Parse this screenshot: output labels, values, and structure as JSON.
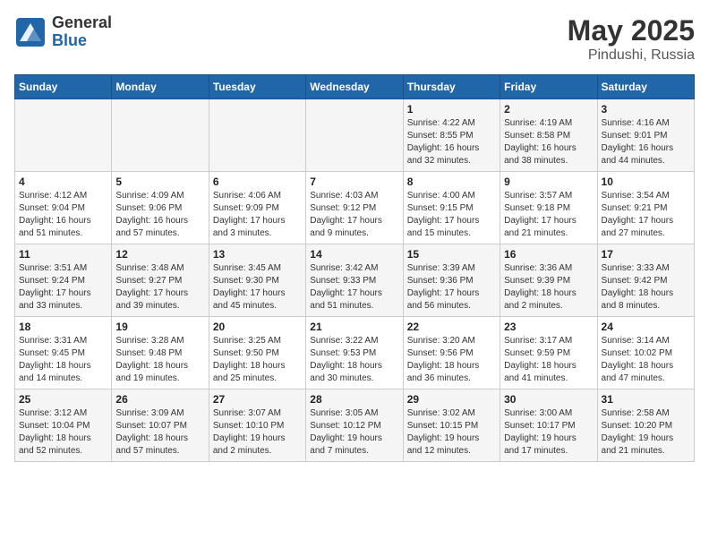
{
  "header": {
    "logo_line1": "General",
    "logo_line2": "Blue",
    "title": "May 2025",
    "subtitle": "Pindushi, Russia"
  },
  "days_of_week": [
    "Sunday",
    "Monday",
    "Tuesday",
    "Wednesday",
    "Thursday",
    "Friday",
    "Saturday"
  ],
  "weeks": [
    [
      {
        "day": "",
        "info": ""
      },
      {
        "day": "",
        "info": ""
      },
      {
        "day": "",
        "info": ""
      },
      {
        "day": "",
        "info": ""
      },
      {
        "day": "1",
        "info": "Sunrise: 4:22 AM\nSunset: 8:55 PM\nDaylight: 16 hours and 32 minutes."
      },
      {
        "day": "2",
        "info": "Sunrise: 4:19 AM\nSunset: 8:58 PM\nDaylight: 16 hours and 38 minutes."
      },
      {
        "day": "3",
        "info": "Sunrise: 4:16 AM\nSunset: 9:01 PM\nDaylight: 16 hours and 44 minutes."
      }
    ],
    [
      {
        "day": "4",
        "info": "Sunrise: 4:12 AM\nSunset: 9:04 PM\nDaylight: 16 hours and 51 minutes."
      },
      {
        "day": "5",
        "info": "Sunrise: 4:09 AM\nSunset: 9:06 PM\nDaylight: 16 hours and 57 minutes."
      },
      {
        "day": "6",
        "info": "Sunrise: 4:06 AM\nSunset: 9:09 PM\nDaylight: 17 hours and 3 minutes."
      },
      {
        "day": "7",
        "info": "Sunrise: 4:03 AM\nSunset: 9:12 PM\nDaylight: 17 hours and 9 minutes."
      },
      {
        "day": "8",
        "info": "Sunrise: 4:00 AM\nSunset: 9:15 PM\nDaylight: 17 hours and 15 minutes."
      },
      {
        "day": "9",
        "info": "Sunrise: 3:57 AM\nSunset: 9:18 PM\nDaylight: 17 hours and 21 minutes."
      },
      {
        "day": "10",
        "info": "Sunrise: 3:54 AM\nSunset: 9:21 PM\nDaylight: 17 hours and 27 minutes."
      }
    ],
    [
      {
        "day": "11",
        "info": "Sunrise: 3:51 AM\nSunset: 9:24 PM\nDaylight: 17 hours and 33 minutes."
      },
      {
        "day": "12",
        "info": "Sunrise: 3:48 AM\nSunset: 9:27 PM\nDaylight: 17 hours and 39 minutes."
      },
      {
        "day": "13",
        "info": "Sunrise: 3:45 AM\nSunset: 9:30 PM\nDaylight: 17 hours and 45 minutes."
      },
      {
        "day": "14",
        "info": "Sunrise: 3:42 AM\nSunset: 9:33 PM\nDaylight: 17 hours and 51 minutes."
      },
      {
        "day": "15",
        "info": "Sunrise: 3:39 AM\nSunset: 9:36 PM\nDaylight: 17 hours and 56 minutes."
      },
      {
        "day": "16",
        "info": "Sunrise: 3:36 AM\nSunset: 9:39 PM\nDaylight: 18 hours and 2 minutes."
      },
      {
        "day": "17",
        "info": "Sunrise: 3:33 AM\nSunset: 9:42 PM\nDaylight: 18 hours and 8 minutes."
      }
    ],
    [
      {
        "day": "18",
        "info": "Sunrise: 3:31 AM\nSunset: 9:45 PM\nDaylight: 18 hours and 14 minutes."
      },
      {
        "day": "19",
        "info": "Sunrise: 3:28 AM\nSunset: 9:48 PM\nDaylight: 18 hours and 19 minutes."
      },
      {
        "day": "20",
        "info": "Sunrise: 3:25 AM\nSunset: 9:50 PM\nDaylight: 18 hours and 25 minutes."
      },
      {
        "day": "21",
        "info": "Sunrise: 3:22 AM\nSunset: 9:53 PM\nDaylight: 18 hours and 30 minutes."
      },
      {
        "day": "22",
        "info": "Sunrise: 3:20 AM\nSunset: 9:56 PM\nDaylight: 18 hours and 36 minutes."
      },
      {
        "day": "23",
        "info": "Sunrise: 3:17 AM\nSunset: 9:59 PM\nDaylight: 18 hours and 41 minutes."
      },
      {
        "day": "24",
        "info": "Sunrise: 3:14 AM\nSunset: 10:02 PM\nDaylight: 18 hours and 47 minutes."
      }
    ],
    [
      {
        "day": "25",
        "info": "Sunrise: 3:12 AM\nSunset: 10:04 PM\nDaylight: 18 hours and 52 minutes."
      },
      {
        "day": "26",
        "info": "Sunrise: 3:09 AM\nSunset: 10:07 PM\nDaylight: 18 hours and 57 minutes."
      },
      {
        "day": "27",
        "info": "Sunrise: 3:07 AM\nSunset: 10:10 PM\nDaylight: 19 hours and 2 minutes."
      },
      {
        "day": "28",
        "info": "Sunrise: 3:05 AM\nSunset: 10:12 PM\nDaylight: 19 hours and 7 minutes."
      },
      {
        "day": "29",
        "info": "Sunrise: 3:02 AM\nSunset: 10:15 PM\nDaylight: 19 hours and 12 minutes."
      },
      {
        "day": "30",
        "info": "Sunrise: 3:00 AM\nSunset: 10:17 PM\nDaylight: 19 hours and 17 minutes."
      },
      {
        "day": "31",
        "info": "Sunrise: 2:58 AM\nSunset: 10:20 PM\nDaylight: 19 hours and 21 minutes."
      }
    ]
  ]
}
